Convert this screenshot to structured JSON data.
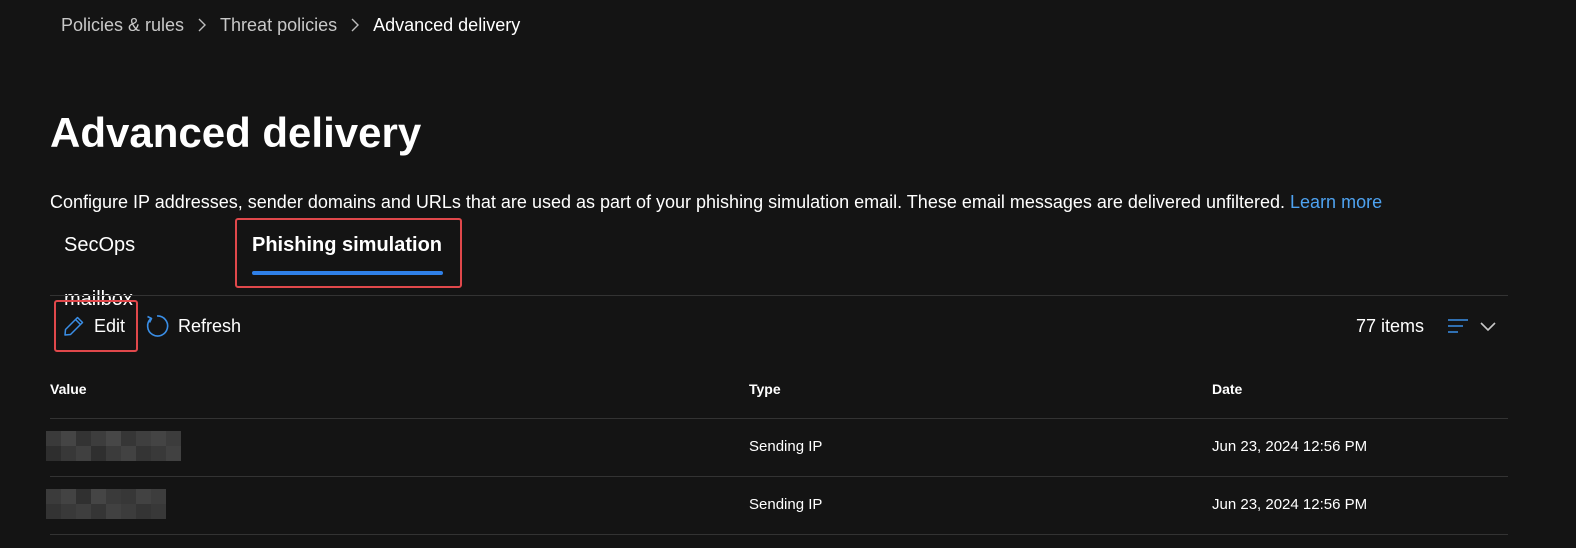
{
  "breadcrumb": {
    "items": [
      "Policies & rules",
      "Threat policies",
      "Advanced delivery"
    ]
  },
  "page": {
    "title": "Advanced delivery",
    "description": "Configure IP addresses, sender domains and URLs that are used as part of your phishing simulation email. These email messages are delivered unfiltered.",
    "learn_more": "Learn more"
  },
  "tabs": [
    {
      "label": "SecOps mailbox",
      "selected": false
    },
    {
      "label": "Phishing simulation",
      "selected": true
    }
  ],
  "toolbar": {
    "edit_label": "Edit",
    "refresh_label": "Refresh",
    "item_count": "77 items"
  },
  "table": {
    "columns": [
      "Value",
      "Type",
      "Date"
    ],
    "rows": [
      {
        "value": "",
        "type": "Sending IP",
        "date": "Jun 23, 2024 12:56 PM"
      },
      {
        "value": "",
        "type": "Sending IP",
        "date": "Jun 23, 2024 12:56 PM"
      }
    ]
  },
  "colors": {
    "accent": "#2f80e8",
    "link": "#4ea2f0",
    "highlight_border": "#e0484b",
    "background": "#141414"
  },
  "icons": {
    "breadcrumb_separator": "chevron-right-icon",
    "edit": "pencil-icon",
    "refresh": "refresh-icon",
    "sort": "list-sort-icon",
    "dropdown": "chevron-down-icon"
  }
}
